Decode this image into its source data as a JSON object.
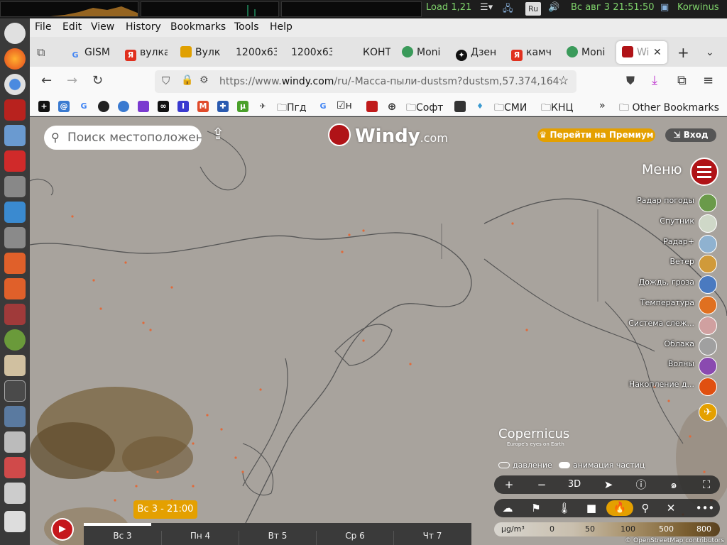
{
  "system": {
    "load": "Load 1,21",
    "lang": "Ru",
    "clock": "Вс авг  3 21:51:50",
    "user": "Korwinus"
  },
  "menu": {
    "file": "File",
    "edit": "Edit",
    "view": "View",
    "history": "History",
    "bookmarks": "Bookmarks",
    "tools": "Tools",
    "help": "Help"
  },
  "tabs": [
    {
      "label": "GISM",
      "icon": "google-icon"
    },
    {
      "label": "вулка",
      "icon": "yandex-icon"
    },
    {
      "label": "Вулк",
      "icon": "image-icon"
    },
    {
      "label": "1200x63",
      "icon": ""
    },
    {
      "label": "1200x63",
      "icon": ""
    },
    {
      "label": "КОНТ",
      "icon": ""
    },
    {
      "label": "Moni",
      "icon": "monitor-icon"
    },
    {
      "label": "Дзен",
      "icon": "dzen-icon"
    },
    {
      "label": "камч",
      "icon": "yandex-icon"
    },
    {
      "label": "Moni",
      "icon": "monitor-icon"
    },
    {
      "label": "Wi",
      "icon": "windy-icon"
    }
  ],
  "url": {
    "prefix": "https://www.",
    "domain": "windy.com",
    "rest": "/ru/-Масса-пыли-dustsm?dustsm,57.374,164"
  },
  "bookmarks": {
    "pgd": "Пгд",
    "n": "н",
    "soft": "Софт",
    "smi": "СМИ",
    "knc": "КНЦ",
    "other": "Other Bookmarks"
  },
  "windy": {
    "search_placeholder": "Поиск местоположен",
    "logo": "Windy",
    "logo_suffix": ".com",
    "premium": "Перейти на Премиум",
    "login": "Вход",
    "menu": "Меню"
  },
  "layers": [
    {
      "label": "Радар погоды",
      "color": "#6a9a4a"
    },
    {
      "label": "Спутник",
      "color": "#cfd8c8"
    },
    {
      "label": "Радар+",
      "color": "#8fb2d0"
    },
    {
      "label": "Ветер",
      "color": "#d09a3a"
    },
    {
      "label": "Дождь, гроза",
      "color": "#4a7ac0"
    },
    {
      "label": "Температура",
      "color": "#e07020"
    },
    {
      "label": "Система слеж...",
      "color": "#d0a0a0"
    },
    {
      "label": "Облака",
      "color": "#a0a0a0"
    },
    {
      "label": "Волны",
      "color": "#8a4ab0"
    },
    {
      "label": "Накопление д...",
      "color": "#e05010"
    }
  ],
  "attribution": {
    "copernicus": "opernicus",
    "copernicus_sub": "Europe's eyes on Earth",
    "osm": "© OpenStreetMap contributors"
  },
  "toggles": {
    "pressure": "давление",
    "particles": "анимация частиц"
  },
  "controls": {
    "plus": "+",
    "minus": "−",
    "threed": "3D"
  },
  "legend": {
    "unit": "μg/m³",
    "v0": "0",
    "v1": "50",
    "v2": "100",
    "v3": "500",
    "v4": "800"
  },
  "timeline": {
    "current": "Вс 3 - 21:00",
    "days": [
      "Вс 3",
      "Пн 4",
      "Вт 5",
      "Ср 6",
      "Чт 7"
    ]
  }
}
